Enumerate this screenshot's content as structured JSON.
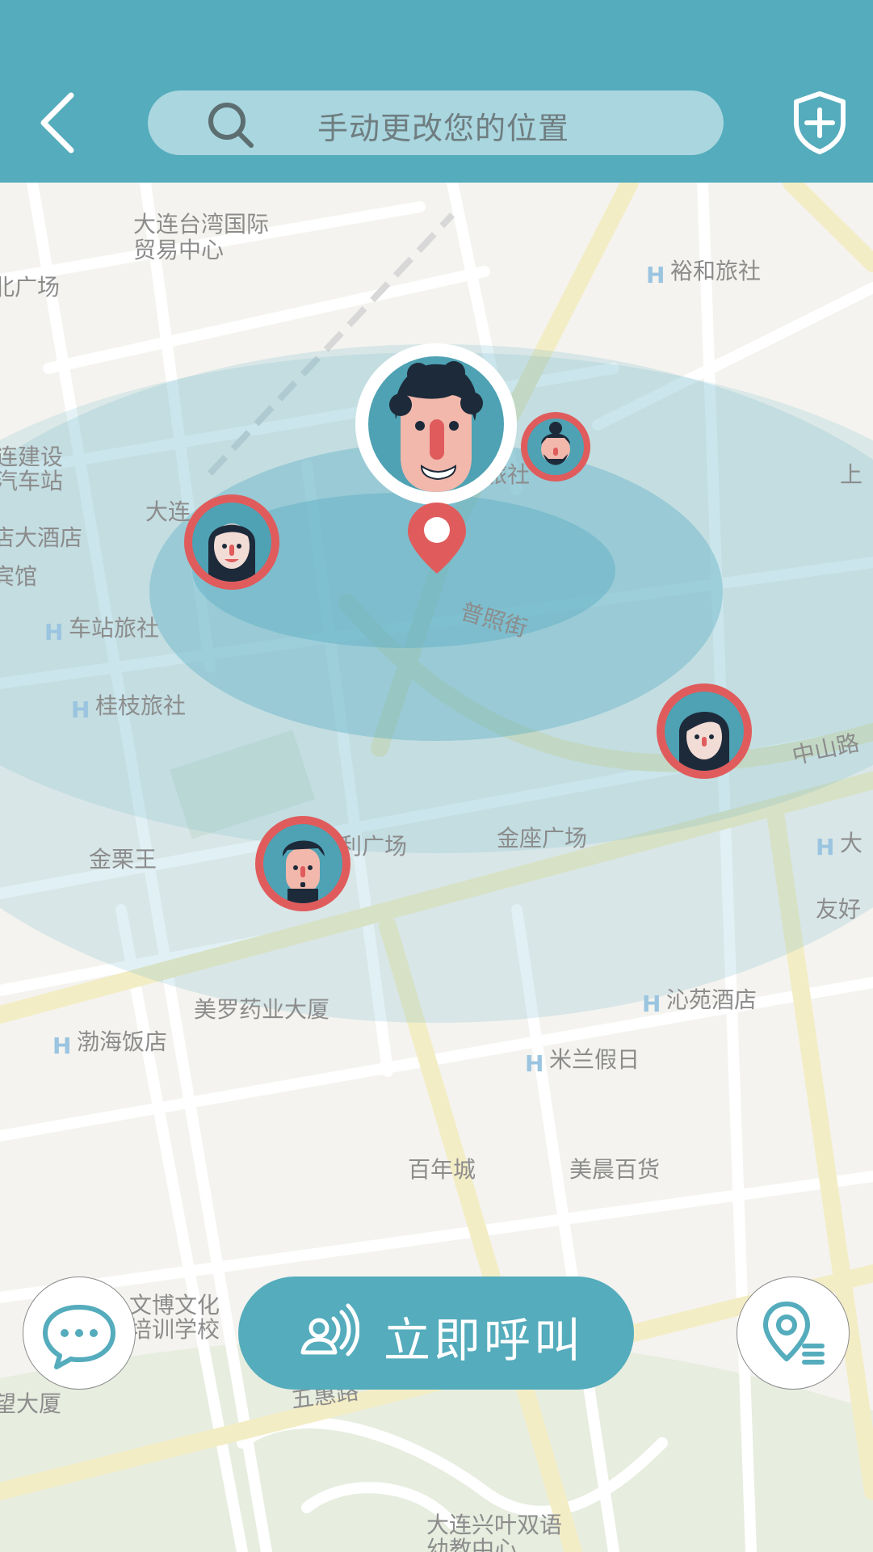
{
  "header": {
    "search_placeholder": "手动更改您的位置",
    "back_icon": "chevron-left-icon",
    "shield_icon": "shield-plus-icon"
  },
  "map": {
    "labels": {
      "l1": "大连台湾国际",
      "l1b": "贸易中心",
      "l2": "北广场",
      "l3": "裕和旅社",
      "l4": "连建设",
      "l4b": "汽车站",
      "l5": "大连",
      "l6": "店大酒店",
      "l7": "宾馆",
      "l8": "车站旅社",
      "l9": "桂枝旅社",
      "l10": "普照街",
      "l11": "中山路",
      "l12": "利广场",
      "l13": "金座广场",
      "l14": "金栗王",
      "l15": "大",
      "l16": "友好",
      "l17": "美罗药业大厦",
      "l18": "沁苑酒店",
      "l19": "渤海饭店",
      "l20": "米兰假日",
      "l21": "百年城",
      "l22": "美晨百货",
      "l23": "文博文化",
      "l23b": "培训学校",
      "l24": "望大厦",
      "l25": "五惠路",
      "l26": "大连兴叶双语",
      "l26b": "幼教中心",
      "l27": "旅社",
      "l28": "上"
    }
  },
  "actions": {
    "call_label": "立即呼叫",
    "chat_icon": "chat-bubble-icon",
    "location_list_icon": "location-list-icon",
    "call_icon": "voice-call-icon"
  },
  "colors": {
    "header": "#54acbc",
    "accent_red": "#e05c5c",
    "search_bg": "#a9d6df"
  }
}
